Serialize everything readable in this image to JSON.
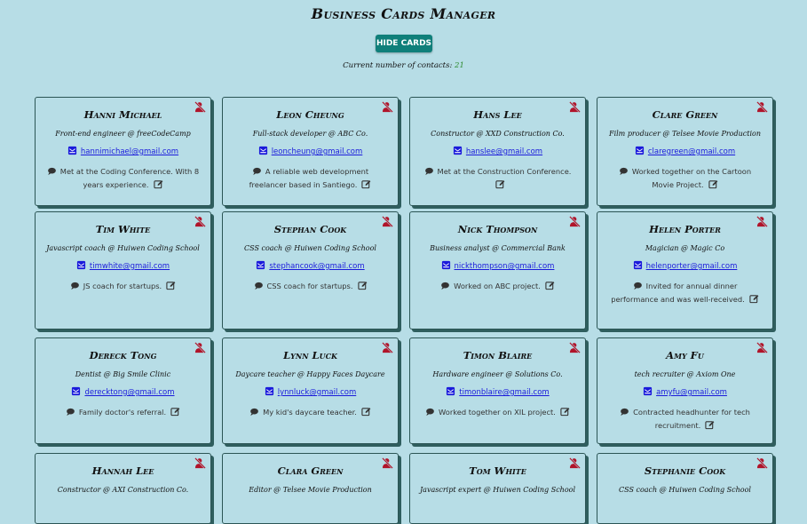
{
  "app_title": "Business Cards Manager",
  "hide_button_label": "HIDE CARDS",
  "contact_count_label": "Current number of contacts:",
  "contact_count": "21",
  "colors": {
    "background": "#b7dde6",
    "button": "#0f7f7a",
    "delete_icon": "#b0142a",
    "mail_icon": "#1a1adb",
    "link": "#1a1adb"
  },
  "icons": {
    "delete": "user-delete-icon",
    "email": "envelope-icon",
    "note": "chat-bubble-icon",
    "edit": "edit-icon"
  },
  "cards": [
    {
      "name": "Hanni Michael",
      "title": "Front-end engineer @ freeCodeCamp",
      "email": "hannimichael@gmail.com",
      "note": "Met at the Coding Conference. With 8 years experience."
    },
    {
      "name": "Leon Cheung",
      "title": "Full-stack developer @ ABC Co.",
      "email": "leoncheung@gmail.com",
      "note": "A reliable web development freelancer based in Santiego."
    },
    {
      "name": "Hans Lee",
      "title": "Constructor @ XXD Construction Co.",
      "email": "hanslee@gmail.com",
      "note": "Met at the Construction Conference."
    },
    {
      "name": "Clare Green",
      "title": "Film producer @ Telsee Movie Production",
      "email": "claregreen@gmail.com",
      "note": "Worked together on the Cartoon Movie Project."
    },
    {
      "name": "Tim White",
      "title": "Javascript coach @ Huiwen Coding School",
      "email": "timwhite@gmail.com",
      "note": "JS coach for startups."
    },
    {
      "name": "Stephan Cook",
      "title": "CSS coach @ Huiwen Coding School",
      "email": "stephancook@gmail.com",
      "note": "CSS coach for startups."
    },
    {
      "name": "Nick Thompson",
      "title": "Business analyst @ Commercial Bank",
      "email": "nickthompson@gmail.com",
      "note": "Worked on ABC project."
    },
    {
      "name": "Helen Porter",
      "title": "Magician @ Magic Co",
      "email": "helenporter@gmail.com",
      "note": "Invited for annual dinner performance and was well-received."
    },
    {
      "name": "Dereck Tong",
      "title": "Dentist @ Big Smile Clinic",
      "email": "derecktong@gmail.com",
      "note": "Family doctor's referral."
    },
    {
      "name": "Lynn Luck",
      "title": "Daycare teacher @ Happy Faces Daycare",
      "email": "lynnluck@gmail.com",
      "note": "My kid's daycare teacher."
    },
    {
      "name": "Timon Blaire",
      "title": "Hardware engineer @ Solutions Co.",
      "email": "timonblaire@gmail.com",
      "note": "Worked together on XIL project."
    },
    {
      "name": "Amy Fu",
      "title": "tech recruiter @ Axiom One",
      "email": "amyfu@gmail.com",
      "note": "Contracted headhunter for tech recruitment."
    },
    {
      "name": "Hannah Lee",
      "title": "Constructor @ AXI Construction Co.",
      "email": "",
      "note": ""
    },
    {
      "name": "Clara Green",
      "title": "Editor @ Telsee Movie Production",
      "email": "",
      "note": ""
    },
    {
      "name": "Tom White",
      "title": "Javascript expert @ Huiwen Coding School",
      "email": "",
      "note": ""
    },
    {
      "name": "Stephanie Cook",
      "title": "CSS coach @ Huiwen Coding School",
      "email": "",
      "note": ""
    }
  ]
}
